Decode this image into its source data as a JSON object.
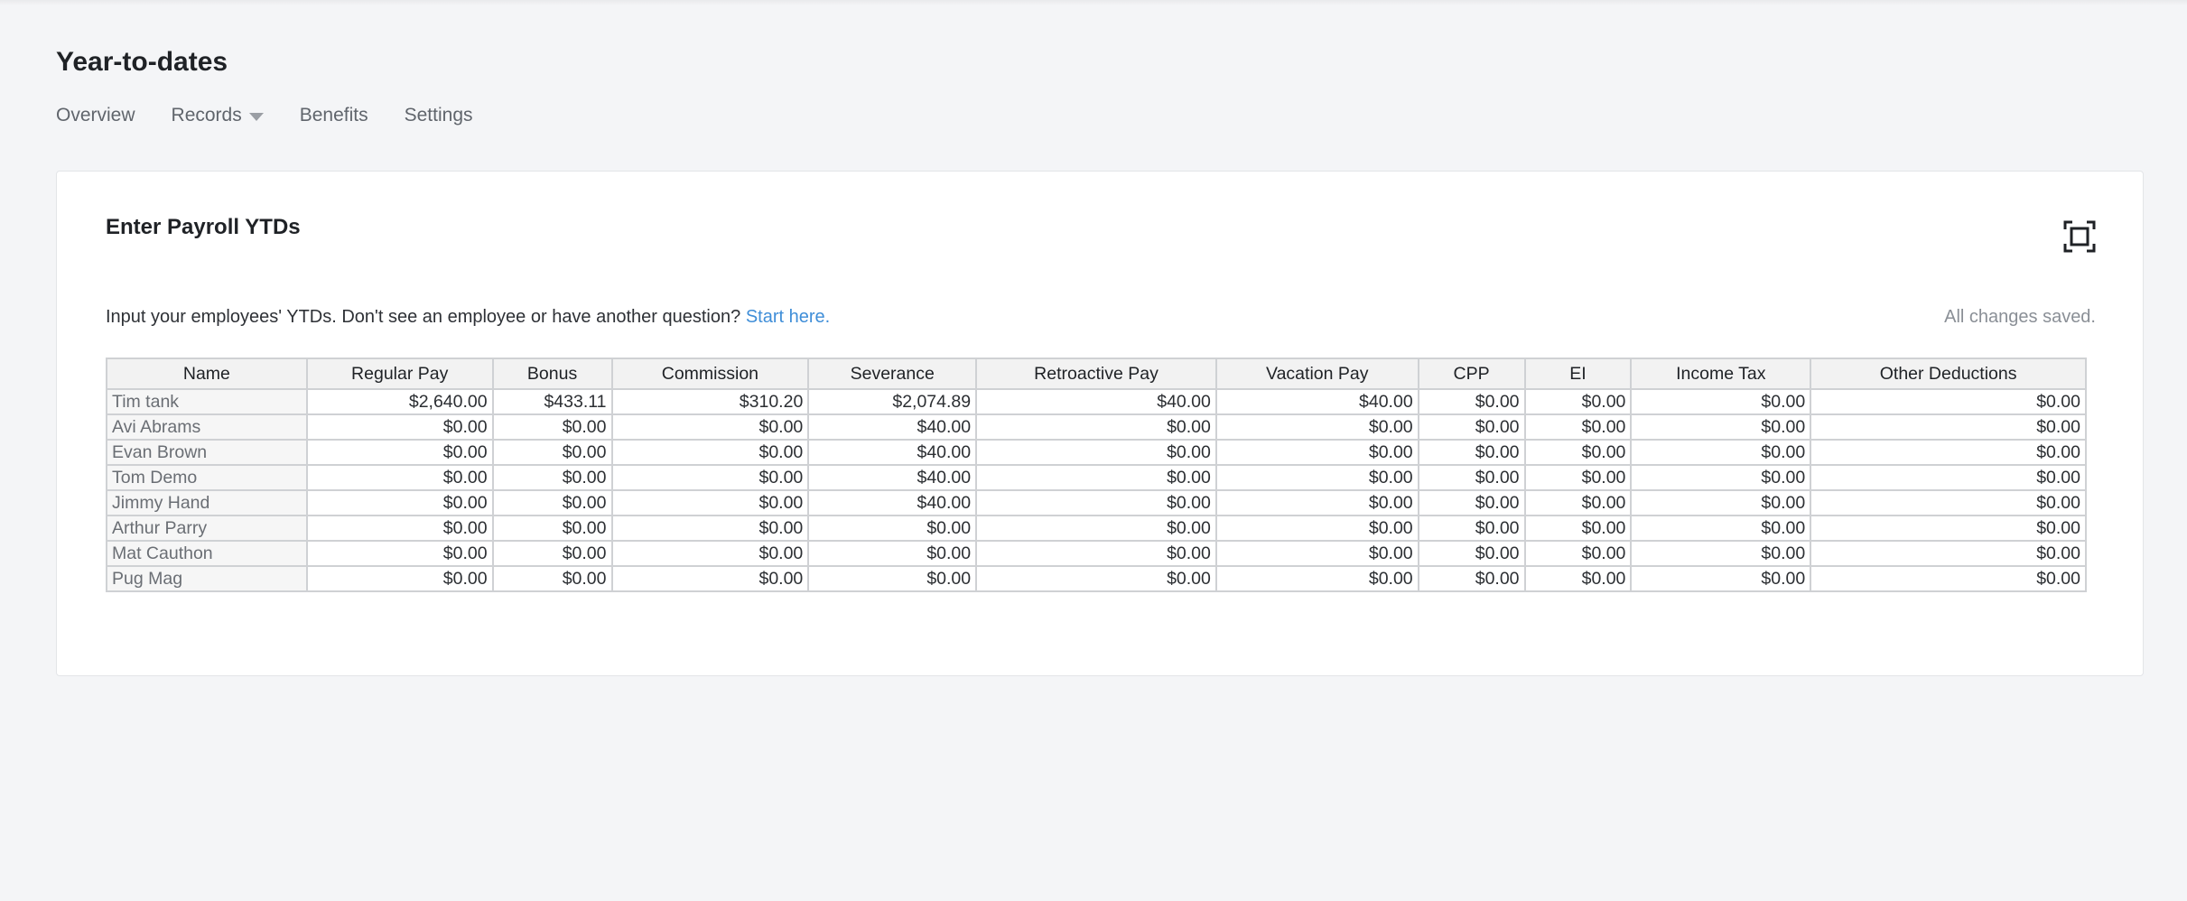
{
  "page": {
    "title": "Year-to-dates",
    "nav": [
      {
        "label": "Overview"
      },
      {
        "label": "Records"
      },
      {
        "label": "Benefits"
      },
      {
        "label": "Settings"
      }
    ]
  },
  "card": {
    "title": "Enter Payroll YTDs",
    "intro_text": "Input your employees' YTDs. Don't see an employee or have another question?",
    "intro_link": "Start here.",
    "status": "All changes saved."
  },
  "table": {
    "columns": [
      "Name",
      "Regular Pay",
      "Bonus",
      "Commission",
      "Severance",
      "Retroactive Pay",
      "Vacation Pay",
      "CPP",
      "EI",
      "Income Tax",
      "Other Deductions"
    ],
    "rows": [
      {
        "name": "Tim tank",
        "cells": [
          "$2,640.00",
          "$433.11",
          "$310.20",
          "$2,074.89",
          "$40.00",
          "$40.00",
          "$0.00",
          "$0.00",
          "$0.00",
          "$0.00"
        ]
      },
      {
        "name": "Avi Abrams",
        "cells": [
          "$0.00",
          "$0.00",
          "$0.00",
          "$40.00",
          "$0.00",
          "$0.00",
          "$0.00",
          "$0.00",
          "$0.00",
          "$0.00"
        ]
      },
      {
        "name": "Evan Brown",
        "cells": [
          "$0.00",
          "$0.00",
          "$0.00",
          "$40.00",
          "$0.00",
          "$0.00",
          "$0.00",
          "$0.00",
          "$0.00",
          "$0.00"
        ]
      },
      {
        "name": "Tom Demo",
        "cells": [
          "$0.00",
          "$0.00",
          "$0.00",
          "$40.00",
          "$0.00",
          "$0.00",
          "$0.00",
          "$0.00",
          "$0.00",
          "$0.00"
        ]
      },
      {
        "name": "Jimmy Hand",
        "cells": [
          "$0.00",
          "$0.00",
          "$0.00",
          "$40.00",
          "$0.00",
          "$0.00",
          "$0.00",
          "$0.00",
          "$0.00",
          "$0.00"
        ]
      },
      {
        "name": "Arthur Parry",
        "cells": [
          "$0.00",
          "$0.00",
          "$0.00",
          "$0.00",
          "$0.00",
          "$0.00",
          "$0.00",
          "$0.00",
          "$0.00",
          "$0.00"
        ]
      },
      {
        "name": "Mat Cauthon",
        "cells": [
          "$0.00",
          "$0.00",
          "$0.00",
          "$0.00",
          "$0.00",
          "$0.00",
          "$0.00",
          "$0.00",
          "$0.00",
          "$0.00"
        ]
      },
      {
        "name": "Pug Mag",
        "cells": [
          "$0.00",
          "$0.00",
          "$0.00",
          "$0.00",
          "$0.00",
          "$0.00",
          "$0.00",
          "$0.00",
          "$0.00",
          "$0.00"
        ]
      }
    ]
  },
  "icons": {
    "expand": "fullscreen-icon",
    "records_dropdown": "caret-down-icon"
  },
  "colors": {
    "link": "#3f8ed8",
    "background": "#f4f5f7"
  }
}
